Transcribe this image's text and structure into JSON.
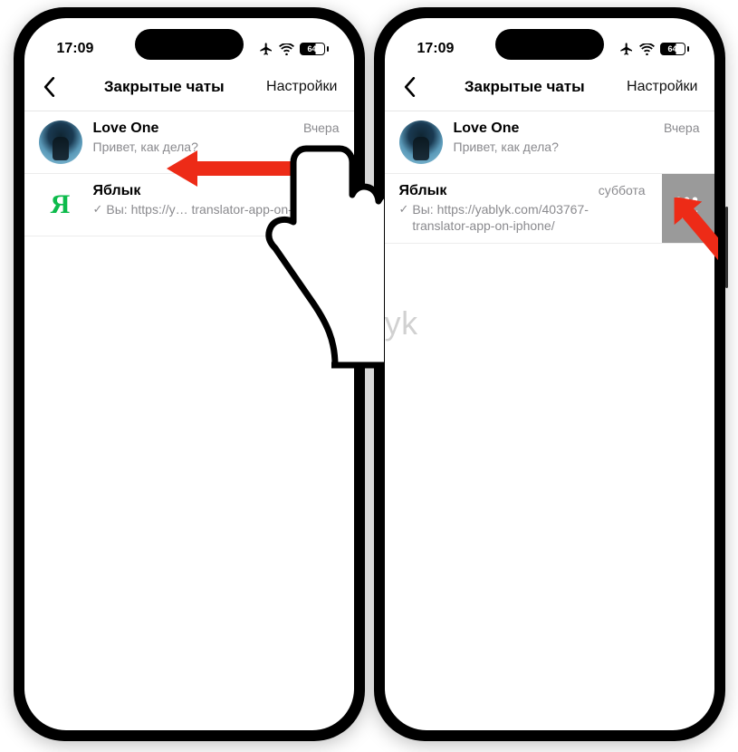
{
  "watermark": "Yablyk",
  "status": {
    "time": "17:09",
    "battery_text": "64"
  },
  "header": {
    "title": "Закрытые чаты",
    "settings_label": "Настройки"
  },
  "phones": {
    "left": {
      "chats": [
        {
          "name": "Love One",
          "preview": "Привет, как дела?",
          "time": "Вчера",
          "tick": false
        },
        {
          "name": "Яблык",
          "avatar_letter": "Я",
          "preview_prefix": "Вы:",
          "preview": "https://y… translator-app-on-iph…e/",
          "time": "…ббота",
          "tick": true
        }
      ]
    },
    "right": {
      "chats": [
        {
          "name": "Love One",
          "preview": "Привет, как дела?",
          "time": "Вчера",
          "tick": false
        },
        {
          "name": "Яблык",
          "preview_prefix": "Вы:",
          "preview": "https://yablyk.com/403767-translator-app-on-iphone/",
          "time": "суббота",
          "tick": true
        }
      ],
      "swipe_action_label": "Ещё"
    }
  }
}
